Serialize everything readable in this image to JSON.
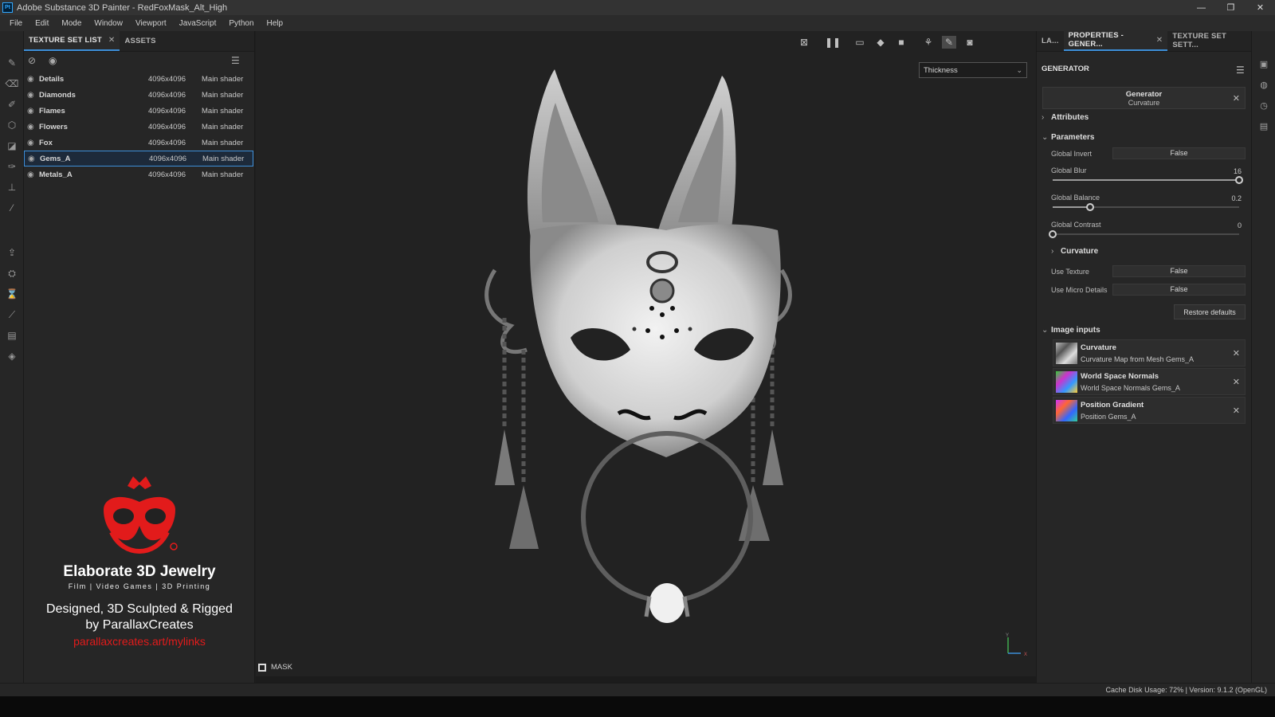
{
  "window": {
    "app_icon": "Pt",
    "title": "Adobe Substance 3D Painter - RedFoxMask_Alt_High",
    "buttons": {
      "minimize": "—",
      "restore": "❐",
      "close": "✕"
    }
  },
  "menu": [
    "File",
    "Edit",
    "Mode",
    "Window",
    "Viewport",
    "JavaScript",
    "Python",
    "Help"
  ],
  "texture_set_panel": {
    "tabs": [
      {
        "label": "TEXTURE SET LIST",
        "close": "✕"
      },
      {
        "label": "ASSETS"
      }
    ],
    "rows": [
      {
        "name": "Details",
        "resolution": "4096x4096",
        "shader": "Main shader"
      },
      {
        "name": "Diamonds",
        "resolution": "4096x4096",
        "shader": "Main shader"
      },
      {
        "name": "Flames",
        "resolution": "4096x4096",
        "shader": "Main shader"
      },
      {
        "name": "Flowers",
        "resolution": "4096x4096",
        "shader": "Main shader"
      },
      {
        "name": "Fox",
        "resolution": "4096x4096",
        "shader": "Main shader"
      },
      {
        "name": "Gems_A",
        "resolution": "4096x4096",
        "shader": "Main shader",
        "selected": true
      },
      {
        "name": "Metals_A",
        "resolution": "4096x4096",
        "shader": "Main shader"
      }
    ]
  },
  "promo": {
    "title": "Elaborate 3D Jewelry",
    "subtitle": "Film | Video Games | 3D Printing",
    "line1": "Designed, 3D Sculpted & Rigged",
    "line2": "by ParallaxCreates",
    "link": "parallaxcreates.art/mylinks",
    "brand_color": "#e21b1b"
  },
  "viewport": {
    "channel": "Thickness",
    "mask_label": "MASK",
    "axis_y": "Y",
    "axis_x": "X"
  },
  "properties_panel": {
    "tabs": [
      {
        "label": "LA..."
      },
      {
        "label": "PROPERTIES - GENER...",
        "close": "✕"
      },
      {
        "label": "TEXTURE SET SETT..."
      }
    ],
    "header": "GENERATOR",
    "generator": {
      "name": "Generator",
      "type": "Curvature"
    },
    "attributes_label": "Attributes",
    "parameters_label": "Parameters",
    "params": {
      "global_invert": {
        "label": "Global Invert",
        "value": "False"
      },
      "global_blur": {
        "label": "Global Blur",
        "value": "16",
        "fraction": 1.0
      },
      "global_balance": {
        "label": "Global Balance",
        "value": "0.2",
        "fraction": 0.2
      },
      "global_contrast": {
        "label": "Global Contrast",
        "value": "0",
        "fraction": 0.0
      }
    },
    "curvature_label": "Curvature",
    "curvature_params": {
      "use_texture": {
        "label": "Use Texture",
        "value": "False"
      },
      "use_micro_details": {
        "label": "Use Micro Details",
        "value": "False"
      }
    },
    "restore_defaults": "Restore defaults",
    "image_inputs_label": "Image inputs",
    "image_inputs": [
      {
        "name": "Curvature",
        "source": "Curvature Map from Mesh Gems_A"
      },
      {
        "name": "World Space Normals",
        "source": "World Space Normals Gems_A"
      },
      {
        "name": "Position Gradient",
        "source": "Position Gems_A"
      }
    ]
  },
  "status": {
    "text": "Cache Disk Usage:    72% | Version: 9.1.2 (OpenGL)"
  },
  "colors": {
    "accent": "#3d8ed8",
    "panel": "#262626",
    "viewport": "#222222"
  }
}
